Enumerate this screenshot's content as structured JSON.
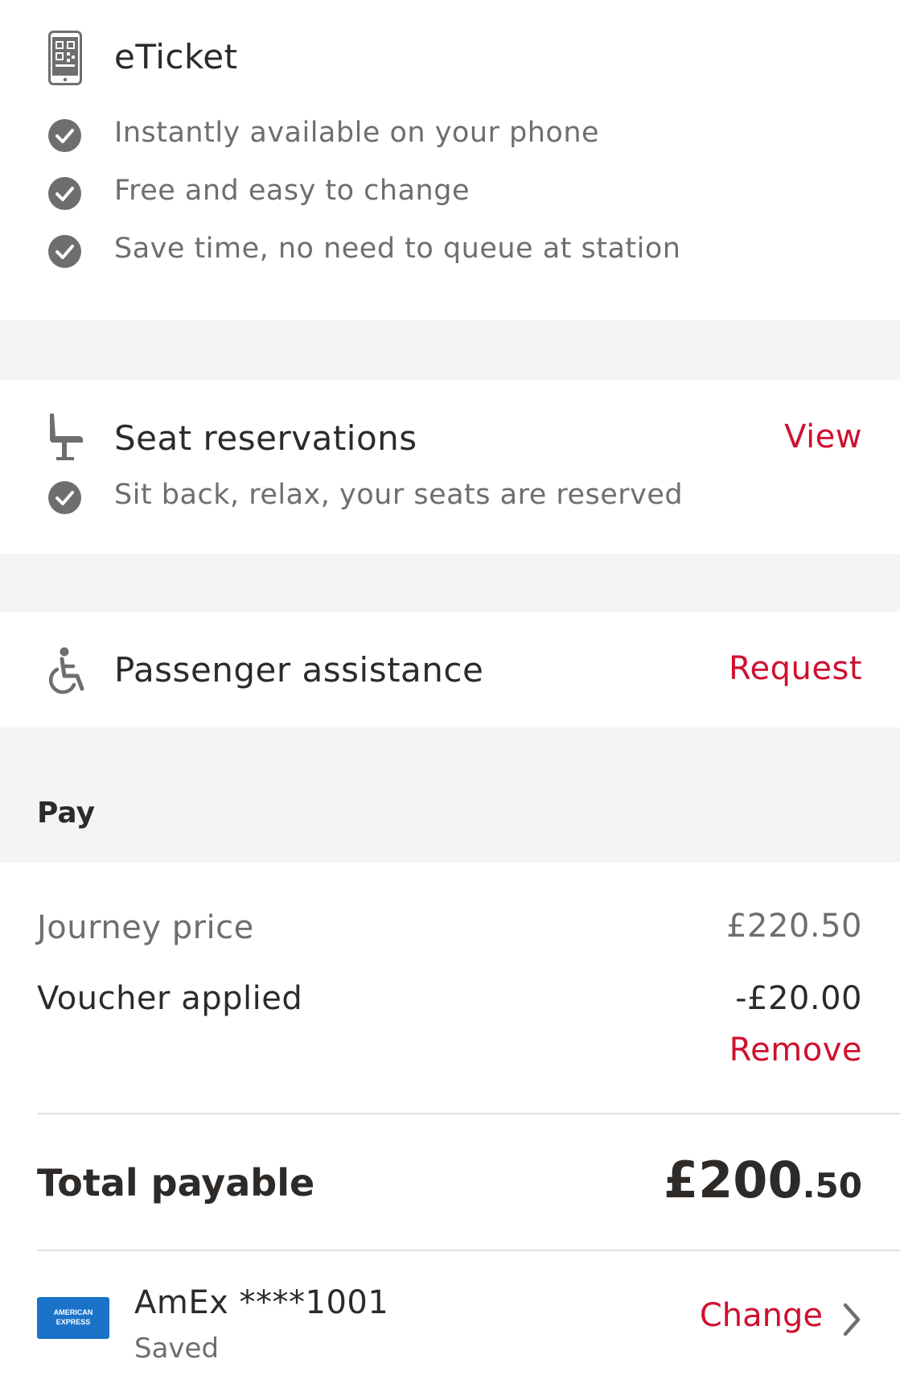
{
  "eticket": {
    "title": "eTicket",
    "icon": "qr-phone-icon",
    "features": [
      "Instantly available on your phone",
      "Free and easy to change",
      "Save time, no need to queue at station"
    ]
  },
  "seats": {
    "title": "Seat reservations",
    "icon": "seat-icon",
    "action": "View",
    "features": [
      "Sit back, relax, your seats are reserved"
    ]
  },
  "assistance": {
    "title": "Passenger assistance",
    "icon": "wheelchair-icon",
    "action": "Request"
  },
  "pay": {
    "header": "Pay",
    "journey_label": "Journey price",
    "journey_value": "£220.50",
    "voucher_label": "Voucher applied",
    "voucher_value": "-£20.00",
    "voucher_remove": "Remove",
    "total_label": "Total payable",
    "total_major": "£200",
    "total_minor": ".50"
  },
  "payment_method": {
    "card_logo_line1": "AMERICAN",
    "card_logo_line2": "EXPRESS",
    "card_name": "AmEx ****1001",
    "card_status": "Saved",
    "change": "Change"
  },
  "colors": {
    "accent": "#d0102f",
    "text_dark": "#2d2a28",
    "text_muted": "#6e6e6e",
    "section_gap": "#f4f4f4",
    "amex_blue": "#1a73c9"
  }
}
